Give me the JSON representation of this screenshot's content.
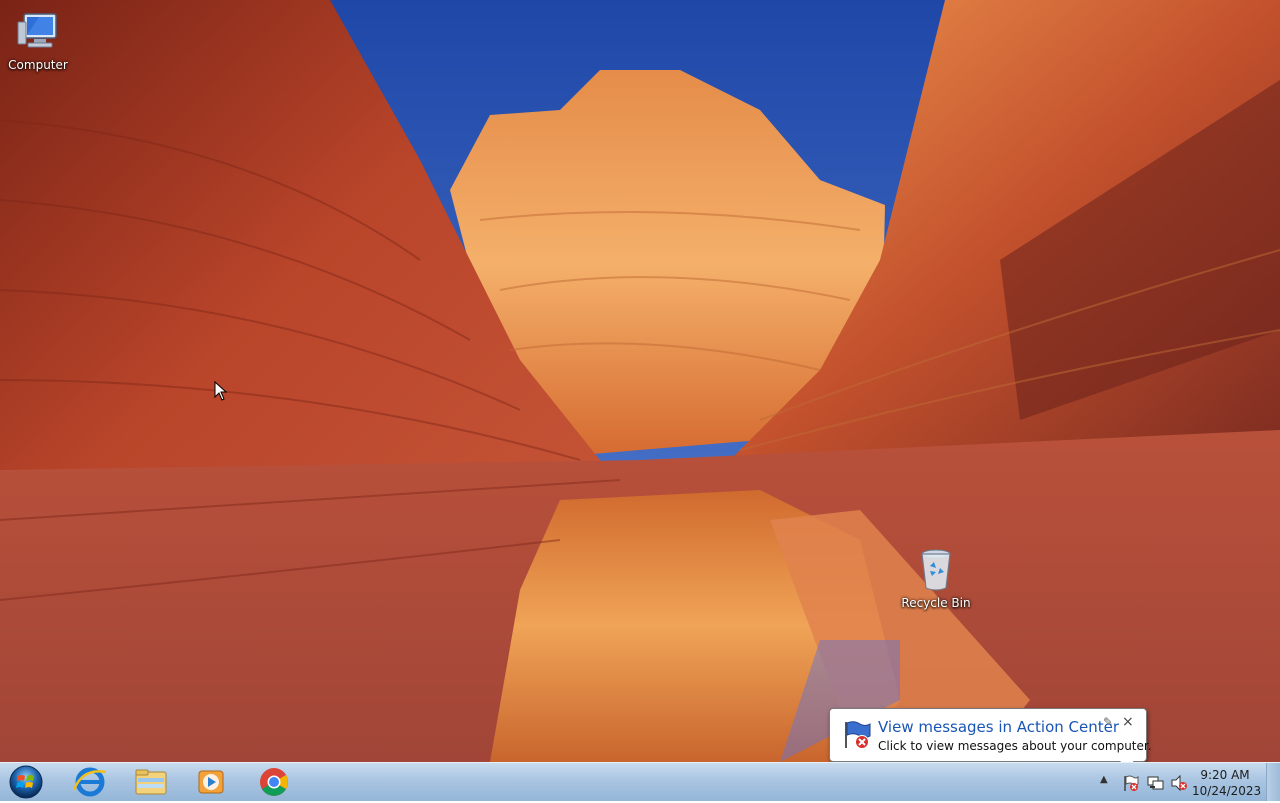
{
  "desktop": {
    "icons": [
      {
        "label": "Computer",
        "icon": "computer-icon"
      },
      {
        "label": "Recycle Bin",
        "icon": "recycle-bin-icon"
      }
    ]
  },
  "notification": {
    "title": "View messages in Action Center",
    "body": "Click to view messages about your computer.",
    "icon": "action-center-flag-icon",
    "close_label": "×"
  },
  "taskbar": {
    "start": "windows-start-orb-icon",
    "pinned": [
      {
        "name": "Internet Explorer",
        "icon": "internet-explorer-icon"
      },
      {
        "name": "Windows Explorer",
        "icon": "file-explorer-icon"
      },
      {
        "name": "Windows Media Player",
        "icon": "media-player-icon"
      },
      {
        "name": "Google Chrome",
        "icon": "chrome-icon"
      }
    ],
    "tray": {
      "overflow_label": "▲",
      "icons": [
        "action-center-flag-icon",
        "network-icon",
        "volume-muted-icon"
      ],
      "time": "9:20 AM",
      "date": "10/24/2023"
    }
  },
  "colors": {
    "sky": "#2a55b8",
    "rock_dark": "#8a2a1c",
    "rock_light": "#f0a050",
    "taskbar": "#a9c5e2",
    "balloon_title": "#1a55b5"
  }
}
